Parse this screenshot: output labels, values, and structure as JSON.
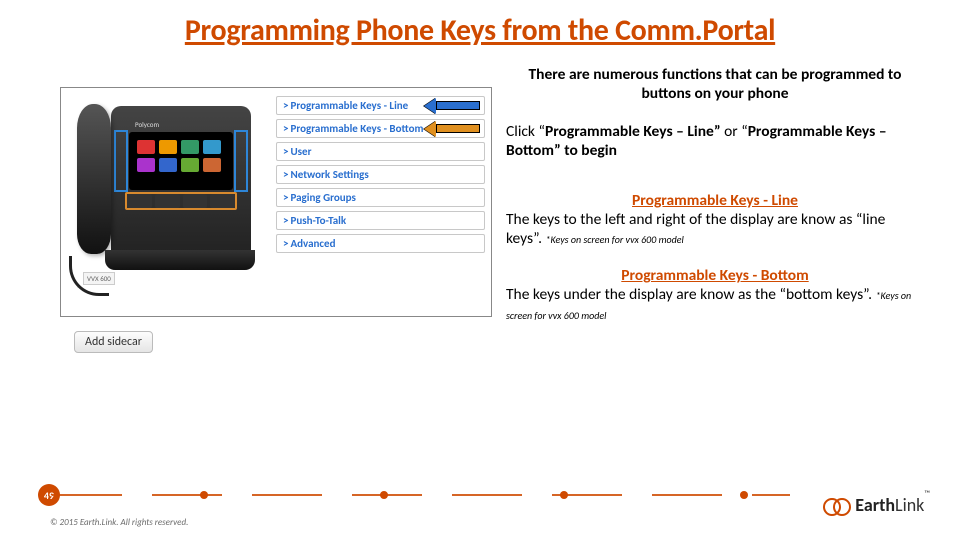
{
  "title": "Programming Phone Keys from the Comm.Portal",
  "screenshot": {
    "phone_brand": "Polycom",
    "phone_label": "VVX 600",
    "add_sidecar_label": "Add sidecar",
    "menu": [
      "Programmable Keys - Line",
      "Programmable Keys - Bottom",
      "User",
      "Network Settings",
      "Paging Groups",
      "Push-To-Talk",
      "Advanced"
    ]
  },
  "text": {
    "intro": "There are numerous functions that can be programmed to buttons on your phone",
    "step_pre": "Click “",
    "step_b1": "Programmable Keys – Line” ",
    "step_mid": "or “",
    "step_b2": "Programmable Keys – Bottom” ",
    "step_post": "to begin",
    "sec1_h": "Programmable Keys - Line",
    "sec1_body": "The keys to the left and right of the display are know as “line keys”. ",
    "sec1_fine": "*Keys on screen for vvx 600 model",
    "sec2_h": "Programmable Keys - Bottom",
    "sec2_body": "The keys under the display are know as the “bottom keys”. ",
    "sec2_fine": "*Keys on screen for vvx 600 model"
  },
  "footer": {
    "page_number": "49",
    "copyright": "© 2015 Earth.Link. All rights reserved.",
    "logo_bold": "Earth",
    "logo_rest": "Link"
  }
}
